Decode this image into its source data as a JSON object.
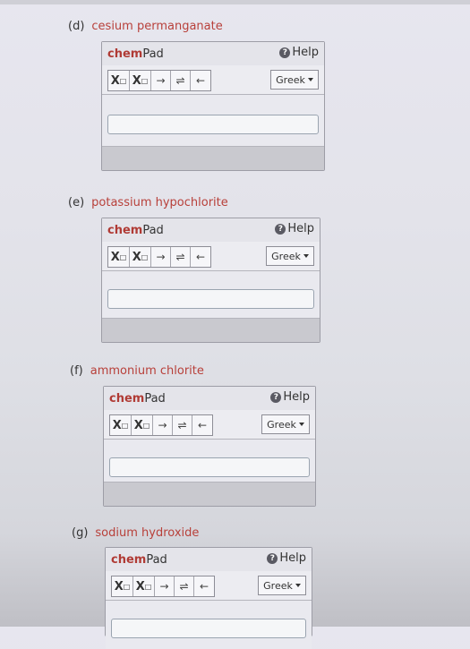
{
  "questions": [
    {
      "letter": "(d)",
      "compound": "cesium permanganate"
    },
    {
      "letter": "(e)",
      "compound": "potassium hypochlorite"
    },
    {
      "letter": "(f)",
      "compound": "ammonium chlorite"
    },
    {
      "letter": "(g)",
      "compound": "sodium hydroxide"
    }
  ],
  "pad": {
    "brand_chem": "chem",
    "brand_pad": "Pad",
    "help_label": "Help",
    "greek_label": "Greek",
    "tools": [
      "subscript-tool",
      "superscript-tool",
      "reaction-arrow-tool",
      "equilibrium-arrow-tool",
      "backspace-tool"
    ]
  },
  "colors": {
    "compound_text": "#b8403a",
    "chem_brand": "#b03b35"
  }
}
